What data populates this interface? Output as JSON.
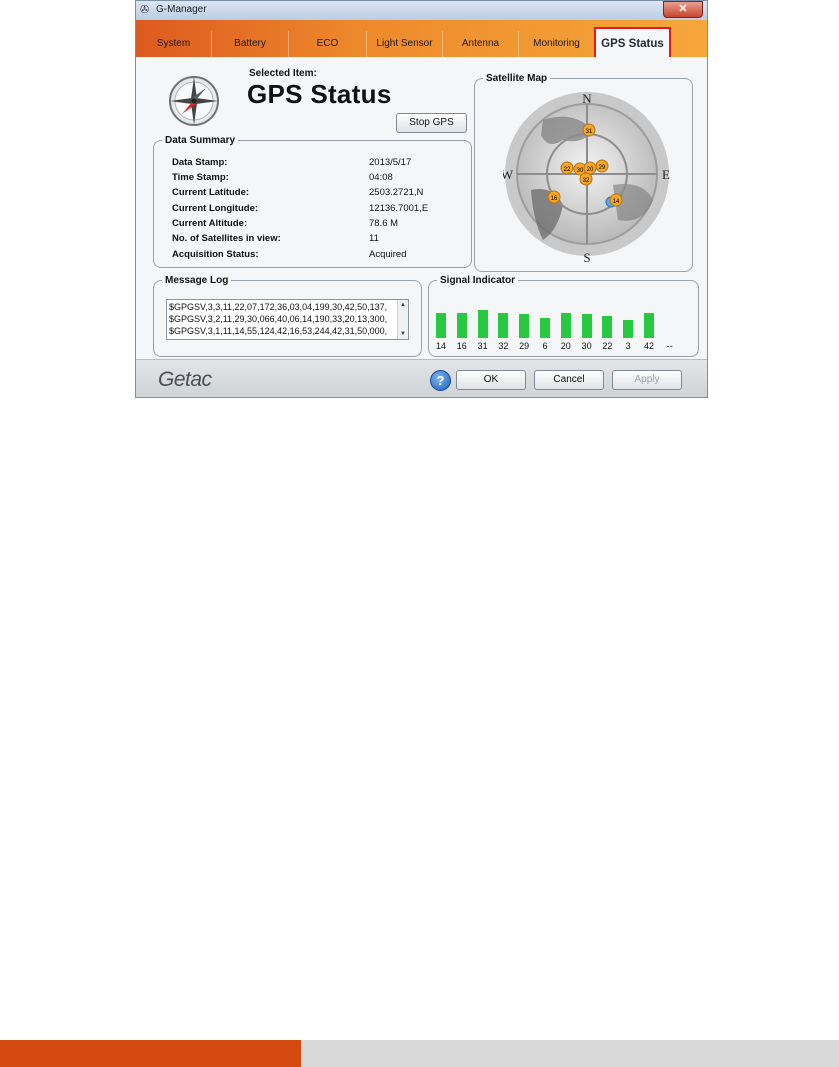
{
  "window": {
    "title": "G-Manager",
    "close_label": "✕"
  },
  "tabs": [
    {
      "label": "System"
    },
    {
      "label": "Battery"
    },
    {
      "label": "ECO"
    },
    {
      "label": "Light Sensor"
    },
    {
      "label": "Antenna"
    },
    {
      "label": "Monitoring"
    },
    {
      "label": "GPS Status",
      "active": true
    }
  ],
  "header": {
    "selected_label": "Selected Item:",
    "title": "GPS Status",
    "stop_button": "Stop GPS"
  },
  "data_summary": {
    "legend": "Data Summary",
    "rows": [
      {
        "key": "Data Stamp:",
        "value": "2013/5/17"
      },
      {
        "key": "Time Stamp:",
        "value": "04:08"
      },
      {
        "key": "Current Latitude:",
        "value": "2503.2721,N"
      },
      {
        "key": "Current Longitude:",
        "value": "12136.7001,E"
      },
      {
        "key": "Current Altitude:",
        "value": "78.6 M"
      },
      {
        "key": "No. of Satellites in view:",
        "value": "11"
      },
      {
        "key": "Acquisition Status:",
        "value": "Acquired"
      }
    ]
  },
  "satellite_map": {
    "legend": "Satellite Map",
    "north": "N",
    "south": "S",
    "east": "E",
    "west": "W",
    "satellites": [
      "31",
      "22",
      "30",
      "20",
      "29",
      "32",
      "16",
      "14"
    ]
  },
  "message_log": {
    "legend": "Message Log",
    "lines": [
      "$GPGSV,3,3,11,22,07,172,36,03,04,199,30,42,50,137,",
      "$GPGSV,3,2,11,29,30,066,40,06,14,190,33,20,13,300,",
      "$GPGSV,3,1,11,14,55,124,42,16,53,244,42,31,50,000,"
    ],
    "scroll_up": "▲",
    "scroll_down": "▼"
  },
  "signal_indicator": {
    "legend": "Signal Indicator",
    "channels": [
      {
        "label": "14",
        "level": 42
      },
      {
        "label": "16",
        "level": 42
      },
      {
        "label": "31",
        "level": 47
      },
      {
        "label": "32",
        "level": 42
      },
      {
        "label": "29",
        "level": 40
      },
      {
        "label": "6",
        "level": 33
      },
      {
        "label": "20",
        "level": 42
      },
      {
        "label": "30",
        "level": 40
      },
      {
        "label": "22",
        "level": 36
      },
      {
        "label": "3",
        "level": 30
      },
      {
        "label": "42",
        "level": 42
      },
      {
        "label": "--",
        "level": 0
      }
    ]
  },
  "footer": {
    "logo": "Getac",
    "help": "?",
    "ok": "OK",
    "cancel": "Cancel",
    "apply": "Apply"
  },
  "colors": {
    "accent": "#d3490f",
    "signal_bar": "#28c840",
    "active_tab_border": "#e11b1b"
  }
}
